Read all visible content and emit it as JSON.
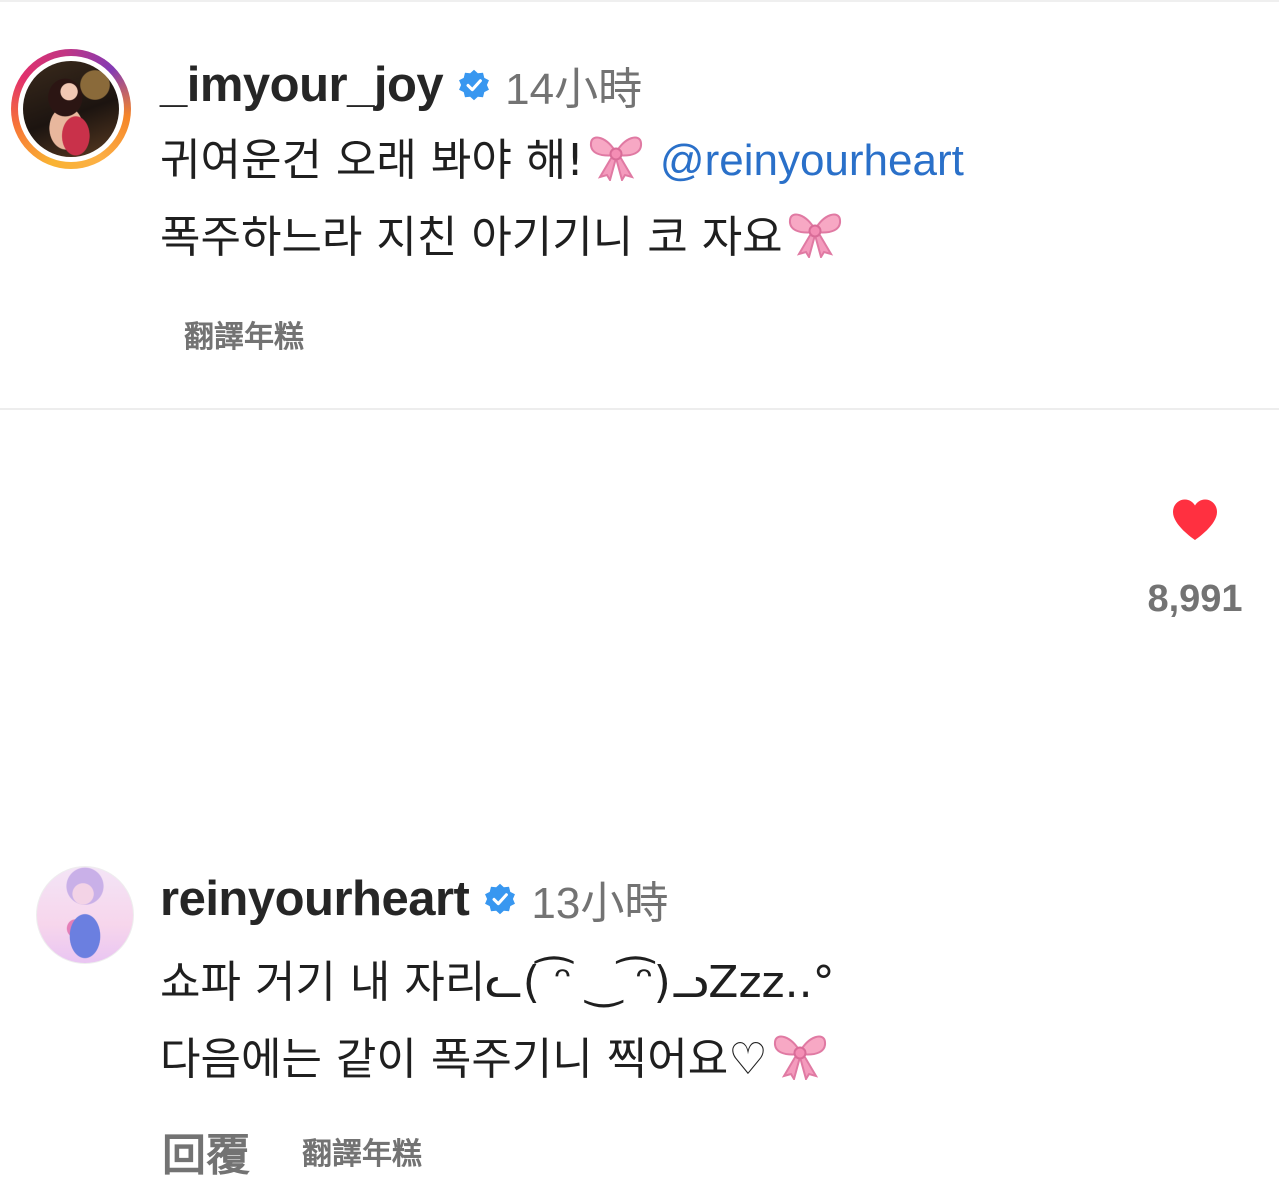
{
  "comments": [
    {
      "username": "_imyour_joy",
      "time": "14小時",
      "text_line1_before": "귀여운건 오래 봐야 해!",
      "mention": "@reinyourheart",
      "text_line2": "폭주하느라 지친 아기기니 코 자요",
      "translate_label": "翻譯年糕",
      "avatar": "avatar-joy",
      "has_story_ring": true
    },
    {
      "username": "reinyourheart",
      "time": "13小時",
      "text_line1": "쇼파 거기 내 자리ᓚ( ͡ᵔ ‿ ͡ᵔ)ᓗZzz..°",
      "text_line2": "다음에는 같이 폭주기니 찍어요♡",
      "reply_label": "回覆",
      "translate_label": "翻譯年糕",
      "like_count": "8,991",
      "liked": true,
      "avatar": "avatar-rein"
    }
  ],
  "colors": {
    "username": "#262626",
    "secondary": "#737373",
    "mention": "#2a70c9",
    "verified": "#3897f0",
    "like": "#ff3040"
  },
  "icons": {
    "verified": "verified-badge-icon",
    "bow": "pink-ribbon-emoji",
    "like": "heart-filled-icon"
  }
}
